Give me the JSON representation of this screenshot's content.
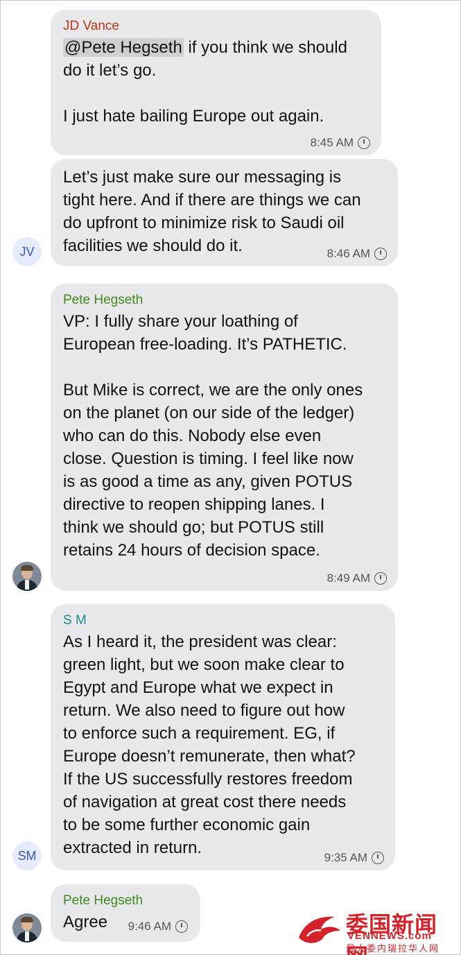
{
  "colors": {
    "bubble_bg": "#e9e9eb",
    "vance_name": "#c4341a",
    "hegseth_name": "#3d8a1e",
    "sm_name": "#1d8c88",
    "initials_text": "#3a55b8",
    "watermark": "#d2232a"
  },
  "messages": [
    {
      "sender": "JD Vance",
      "mention": "@Pete Hegseth",
      "text_after_mention": " if you think we should\ndo it let’s go.\n\nI just hate bailing Europe out again.",
      "time": "8:45 AM",
      "status_icon": "clock-icon"
    },
    {
      "text": "Let’s just make sure our messaging is\ntight here. And if there are things we can\ndo upfront to minimize risk to Saudi oil\nfacilities we should do it.",
      "time": "8:46 AM",
      "status_icon": "clock-icon",
      "avatar_initials": "JV"
    },
    {
      "sender": "Pete Hegseth",
      "text": "VP: I fully share your loathing of\nEuropean free-loading. It’s PATHETIC.\n\nBut Mike is correct, we are the only ones\non the planet (on our side of the ledger)\nwho can do this. Nobody else even\nclose. Question is timing. I feel like now\nis as good a time as any, given POTUS\ndirective to reopen shipping lanes. I\nthink we should go; but POTUS still\nretains 24 hours of decision space.",
      "time": "8:49 AM",
      "status_icon": "clock-icon",
      "avatar": "profile-photo"
    },
    {
      "sender": "S M",
      "text": "As I heard it, the president was clear:\ngreen light, but we soon make clear to\nEgypt and Europe what we expect in\nreturn. We also need to figure out how\nto enforce such a requirement. EG, if\nEurope doesn’t remunerate, then what?\nIf the US successfully restores freedom\nof navigation at great cost there needs\nto be some further economic gain\nextracted in return.",
      "time": "9:35 AM",
      "status_icon": "clock-icon",
      "avatar_initials": "SM"
    },
    {
      "sender": "Pete Hegseth",
      "text": "Agree",
      "time": "9:46 AM",
      "status_icon": "clock-icon",
      "avatar": "profile-photo"
    }
  ],
  "watermark": {
    "chinese_title": "委国新闻网",
    "english": "VENNEWS.com",
    "subtitle": "最大委内瑞拉华人网"
  }
}
